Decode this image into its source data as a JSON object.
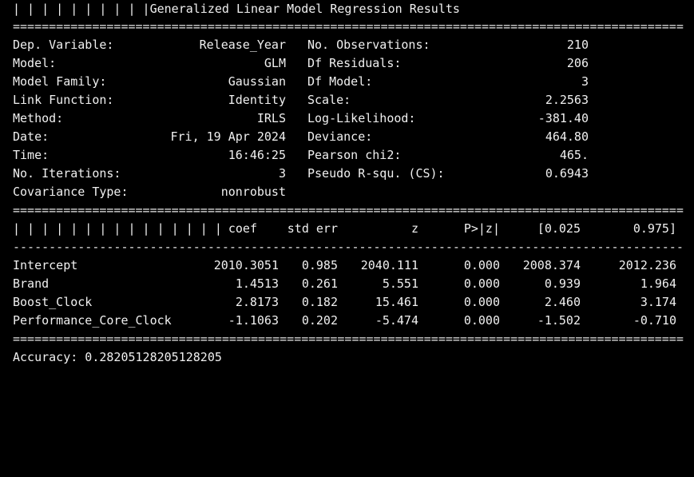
{
  "title": "| | | | | | | | | |Generalized Linear Model Regression Results",
  "rule_double": "==============================================================================================",
  "rule_single": "----------------------------------------------------------------------------------------------",
  "info_left": [
    {
      "label": "Dep. Variable:",
      "value": "Release_Year"
    },
    {
      "label": "Model:",
      "value": "GLM"
    },
    {
      "label": "Model Family:",
      "value": "Gaussian"
    },
    {
      "label": "Link Function:",
      "value": "Identity"
    },
    {
      "label": "Method:",
      "value": "IRLS"
    },
    {
      "label": "Date:",
      "value": "Fri, 19 Apr 2024"
    },
    {
      "label": "Time:",
      "value": "16:46:25"
    },
    {
      "label": "No. Iterations:",
      "value": "3"
    },
    {
      "label": "Covariance Type:",
      "value": "nonrobust"
    }
  ],
  "info_right": [
    {
      "label": "No. Observations:",
      "value": "210"
    },
    {
      "label": "Df Residuals:",
      "value": "206"
    },
    {
      "label": "Df Model:",
      "value": "3"
    },
    {
      "label": "Scale:",
      "value": "2.2563"
    },
    {
      "label": "Log-Likelihood:",
      "value": "-381.40"
    },
    {
      "label": "Deviance:",
      "value": "464.80"
    },
    {
      "label": "Pearson chi2:",
      "value": "465."
    },
    {
      "label": "Pseudo R-squ. (CS):",
      "value": "0.6943"
    }
  ],
  "coef_header": {
    "bars": "| | | | | | | | | | | | | | |",
    "coef": "coef",
    "std_err": "std err",
    "z": "z",
    "p": "P>|z|",
    "ci_low": "[0.025",
    "ci_high": "0.975]"
  },
  "coef_rows": [
    {
      "name": "Intercept",
      "coef": "2010.3051",
      "std_err": "0.985",
      "z": "2040.111",
      "p": "0.000",
      "ci_low": "2008.374",
      "ci_high": "2012.236"
    },
    {
      "name": "Brand",
      "coef": "1.4513",
      "std_err": "0.261",
      "z": "5.551",
      "p": "0.000",
      "ci_low": "0.939",
      "ci_high": "1.964"
    },
    {
      "name": "Boost_Clock",
      "coef": "2.8173",
      "std_err": "0.182",
      "z": "15.461",
      "p": "0.000",
      "ci_low": "2.460",
      "ci_high": "3.174"
    },
    {
      "name": "Performance_Core_Clock",
      "coef": "-1.1063",
      "std_err": "0.202",
      "z": "-5.474",
      "p": "0.000",
      "ci_low": "-1.502",
      "ci_high": "-0.710"
    }
  ],
  "accuracy": "Accuracy: 0.28205128205128205"
}
